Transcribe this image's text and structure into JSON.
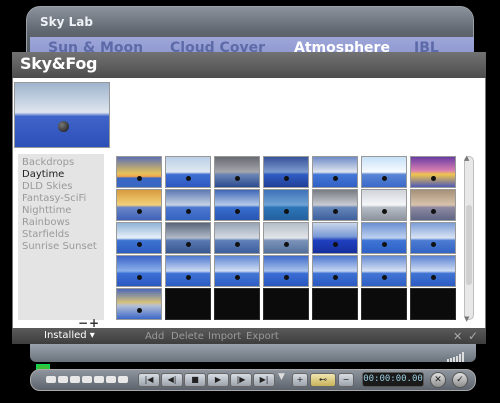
{
  "skylab": {
    "title": "Sky Lab",
    "tabs": [
      "Sun & Moon",
      "Cloud Cover",
      "Atmosphere",
      "IBL"
    ]
  },
  "dialog": {
    "title": "Sky&Fog",
    "categories": [
      "Backdrops",
      "Daytime",
      "DLD Skies",
      "Fantasy-SciFi",
      "Nighttime",
      "Rainbows",
      "Starfields",
      "Sunrise Sunset"
    ],
    "selected_category": "Daytime",
    "remove_label": "−",
    "add_label": "+"
  },
  "bottom_bar": {
    "installed_label": "Installed ▾",
    "actions": [
      "Add",
      "Delete",
      "Import",
      "Export"
    ],
    "close_label": "✕",
    "confirm_label": "✓"
  },
  "timeline": {
    "timecode": "00:00:00.00"
  },
  "icons": {
    "scroll_up": "up-arrow-icon",
    "scroll_down": "down-arrow-icon",
    "first_frame": "skip-back-icon",
    "prev_frame": "step-back-icon",
    "stop": "stop-icon",
    "play": "play-icon",
    "next_frame": "step-forward-icon",
    "last_frame": "skip-forward-icon"
  },
  "colors": {
    "accent": "#8c96cf",
    "active_tab": "#ffffff",
    "timeline_marker": "#36c23a"
  }
}
